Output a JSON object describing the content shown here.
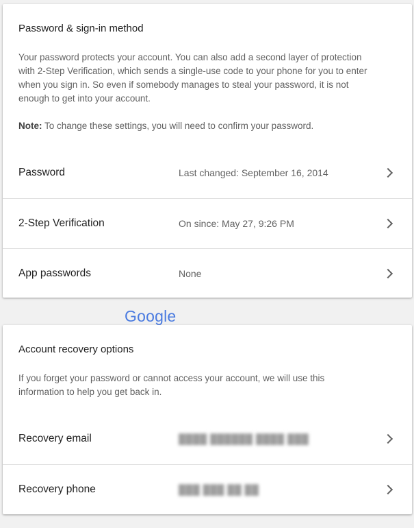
{
  "signin": {
    "title": "Password & sign-in method",
    "description": "Your password protects your account. You can also add a second layer of protection with 2-Step Verification, which sends a single-use code to your phone for you to enter when you sign in. So even if somebody manages to steal your password, it is not enough to get into your account.",
    "note_label": "Note:",
    "note_text": " To change these settings, you will need to confirm your password.",
    "rows": [
      {
        "label": "Password",
        "value": "Last changed: September 16, 2014"
      },
      {
        "label": "2-Step Verification",
        "value": "On since: May 27, 9:26 PM"
      },
      {
        "label": "App passwords",
        "value": "None"
      }
    ]
  },
  "logo": {
    "text": "Google"
  },
  "recovery": {
    "title": "Account recovery options",
    "description": "If you forget your password or cannot access your account, we will use this information to help you get back in.",
    "rows": [
      {
        "label": "Recovery email",
        "value": "",
        "value_redacted": true
      },
      {
        "label": "Recovery phone",
        "value": "",
        "value_redacted": true
      }
    ]
  },
  "icons": {
    "row_chevron": "chevron-right-icon"
  },
  "colors": {
    "logo": "#4a7be0",
    "background": "#f1f1f1",
    "card": "#ffffff"
  }
}
